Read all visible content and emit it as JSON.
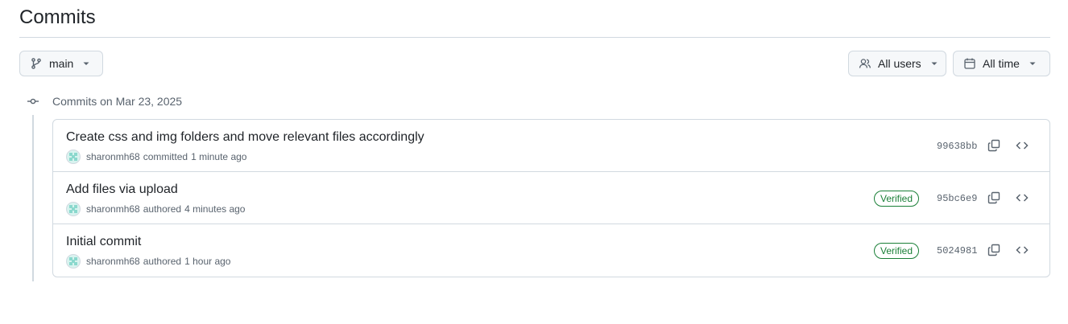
{
  "page": {
    "title": "Commits"
  },
  "toolbar": {
    "branch_label": "main",
    "users_label": "All users",
    "time_label": "All time"
  },
  "group": {
    "title": "Commits on Mar 23, 2025"
  },
  "commits": [
    {
      "message": "Create css and img folders and move relevant files accordingly",
      "author": "sharonmh68",
      "action": "committed",
      "time": "1 minute ago",
      "verified": "",
      "sha": "99638bb"
    },
    {
      "message": "Add files via upload",
      "author": "sharonmh68",
      "action": "authored",
      "time": "4 minutes ago",
      "verified": "Verified",
      "sha": "95bc6e9"
    },
    {
      "message": "Initial commit",
      "author": "sharonmh68",
      "action": "authored",
      "time": "1 hour ago",
      "verified": "Verified",
      "sha": "5024981"
    }
  ],
  "icons": {
    "branch": "git-branch-icon",
    "users": "people-icon",
    "calendar": "calendar-icon",
    "caret": "triangle-down-icon",
    "commit": "git-commit-icon",
    "copy": "copy-icon",
    "browse": "code-icon"
  },
  "colors": {
    "verified": "#1a7f37",
    "border": "#d1d9e0",
    "muted_text": "#59636e",
    "button_bg": "#f6f8fa"
  }
}
